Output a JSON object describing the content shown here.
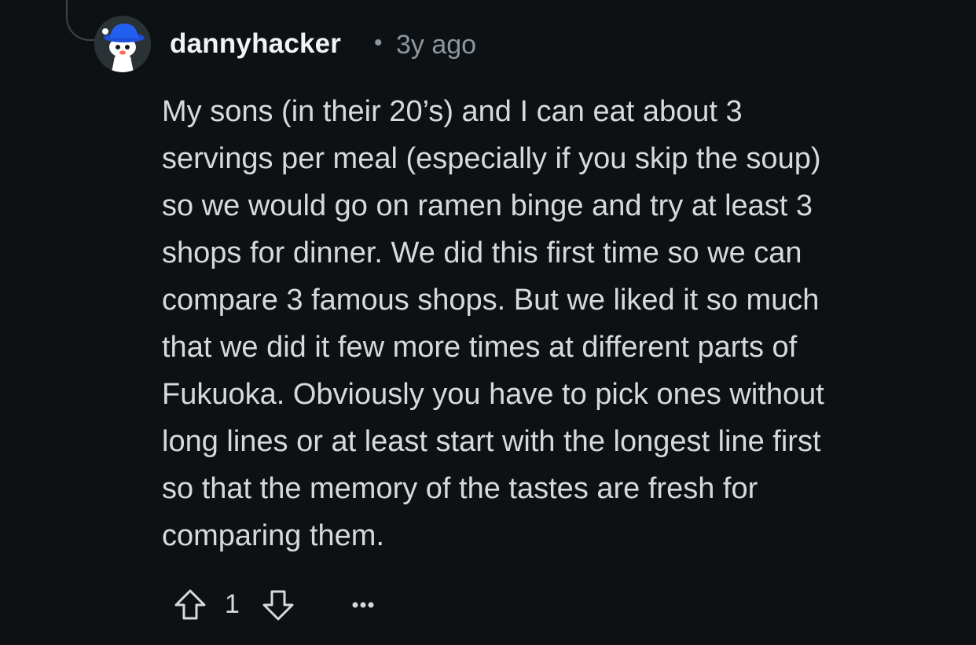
{
  "comment": {
    "username": "dannyhacker",
    "separator": "•",
    "timestamp": "3y ago",
    "body_lines": [
      "My sons (in their 20’s) and I can eat about 3",
      "servings per meal (especially if you skip the soup)",
      "so we would go on ramen binge and try at least 3",
      "shops for dinner. We did this first time so we can",
      "compare 3 famous shops. But we liked it so much",
      "that we did it few more times at different parts of",
      "Fukuoka. Obviously you have to pick ones without",
      "long lines or at least start with the longest line first",
      "so that the memory of the tastes are fresh for",
      "comparing them."
    ],
    "avatar_icon": "snoo-avatar-blue-hat",
    "actions": {
      "upvote_icon": "upvote-arrow-icon",
      "vote_count": "1",
      "downvote_icon": "downvote-arrow-icon",
      "more_icon": "more-options-icon"
    }
  },
  "colors": {
    "background": "#0e1113",
    "text": "#d7dadc",
    "muted": "#8c979f",
    "hat": "#1d4fd8"
  }
}
